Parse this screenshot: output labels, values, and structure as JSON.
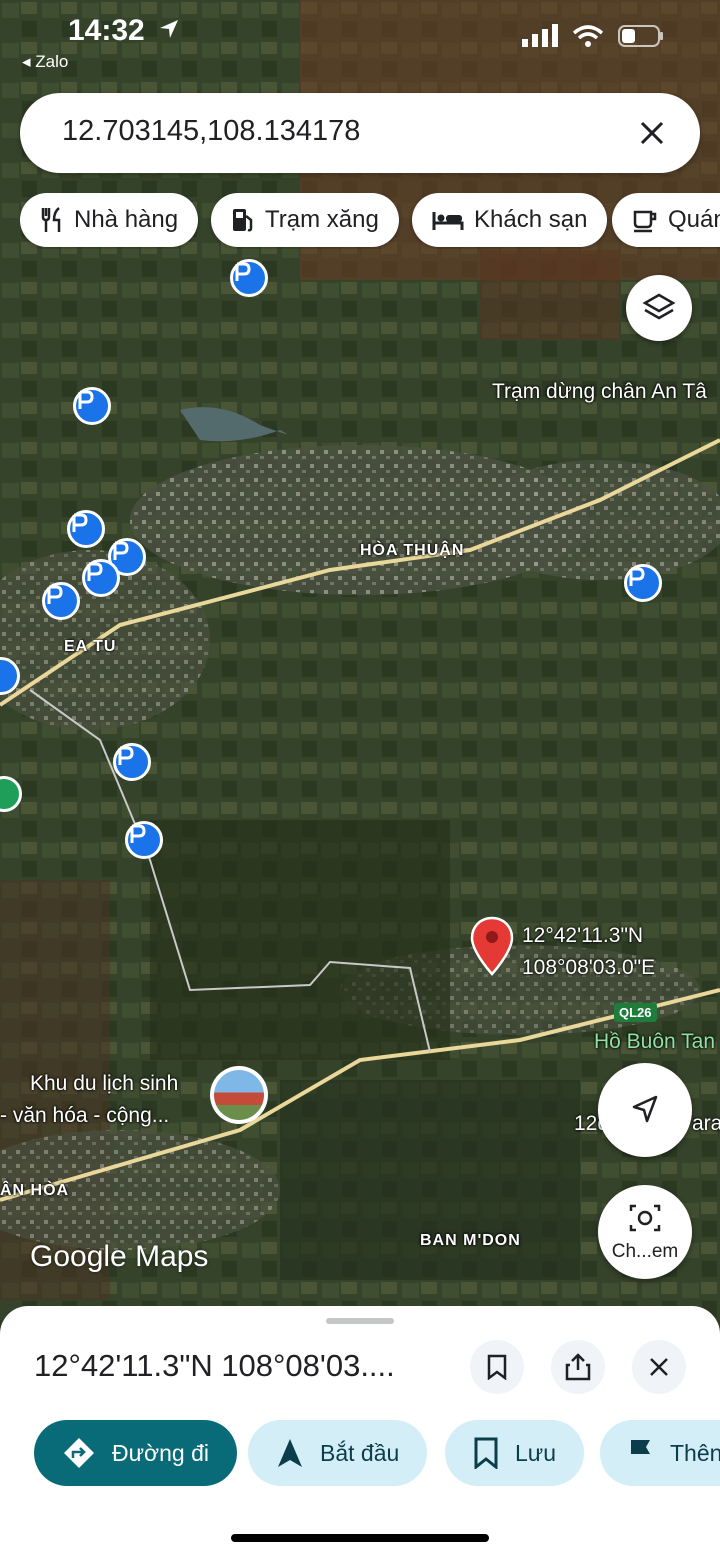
{
  "status_bar": {
    "time": "14:32",
    "back_app": "Zalo"
  },
  "search": {
    "query": "12.703145,108.134178"
  },
  "chips": [
    {
      "label": "Nhà hàng",
      "icon": "restaurant-icon"
    },
    {
      "label": "Trạm xăng",
      "icon": "gas-station-icon"
    },
    {
      "label": "Khách sạn",
      "icon": "hotel-icon"
    },
    {
      "label": "Quán",
      "icon": "cafe-icon"
    }
  ],
  "map": {
    "labels": {
      "rest_stop": "Trạm dừng chân An Tâ",
      "hoa_thuan": "HÒA THUẬN",
      "ea_tu": "EA TU",
      "pin_lat": "12°42'11.3\"N",
      "pin_lng": "108°08'03.0\"E",
      "route": "QL26",
      "lake": "Hồ Buôn Tan",
      "eco_line1": "Khu du lịch sinh",
      "eco_line2": "- văn hóa -  cộng...",
      "coord_partial": "12d",
      "ara": "ara",
      "an_hoa": "ÂN HÒA",
      "ban_mdon": "BAN M'DON"
    },
    "logo": "Google Maps",
    "lens_caption": "Ch...em"
  },
  "sheet": {
    "coordinates": "12°42'11.3\"N 108°08'03....",
    "actions": [
      {
        "label": "Đường đi",
        "icon": "directions-icon"
      },
      {
        "label": "Bắt đầu",
        "icon": "navigation-arrow-icon"
      },
      {
        "label": "Lưu",
        "icon": "bookmark-icon"
      },
      {
        "label": "Thên",
        "icon": "flag-icon"
      }
    ]
  },
  "colors": {
    "pin": "#e53935",
    "marker": "#1a73e8",
    "primary_action": "#0a6b78",
    "action_bg": "#d3eef7"
  }
}
